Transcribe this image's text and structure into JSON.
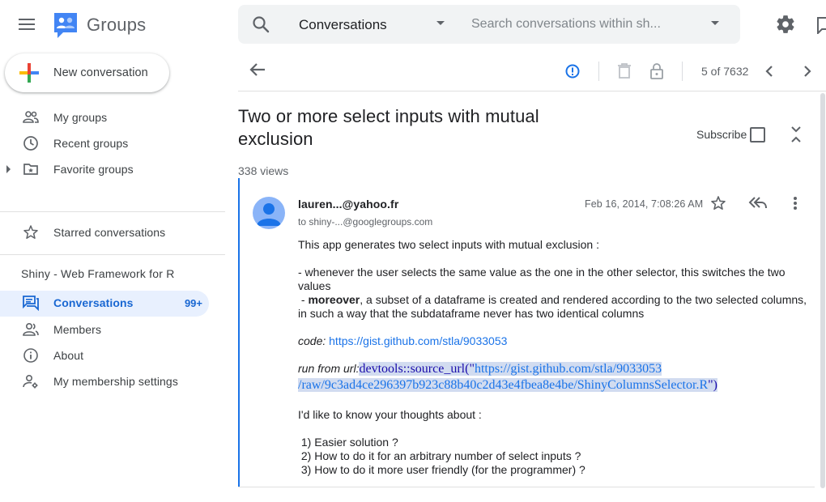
{
  "app": {
    "name": "Groups",
    "new_conversation": "New conversation"
  },
  "search": {
    "scope": "Conversations",
    "placeholder": "Search conversations within sh..."
  },
  "sidebar": {
    "items": [
      {
        "label": "My groups",
        "icon": "people-icon"
      },
      {
        "label": "Recent groups",
        "icon": "clock-icon"
      },
      {
        "label": "Favorite groups",
        "icon": "folder-star-icon"
      },
      {
        "label": "Starred conversations",
        "icon": "star-icon"
      }
    ],
    "group_title": "Shiny - Web Framework for R",
    "group_items": [
      {
        "label": "Conversations",
        "icon": "chat-icon",
        "count": "99+",
        "active": true
      },
      {
        "label": "Members",
        "icon": "members-icon"
      },
      {
        "label": "About",
        "icon": "info-icon"
      },
      {
        "label": "My membership settings",
        "icon": "person-settings-icon"
      }
    ]
  },
  "toolbar": {
    "pager": "5 of 7632"
  },
  "thread": {
    "title": "Two or more select inputs with mutual exclusion",
    "views": "338 views",
    "subscribe": "Subscribe"
  },
  "message": {
    "sender": "lauren...@yahoo.fr",
    "recipient": "to shiny-...@googlegroups.com",
    "date": "Feb 16, 2014, 7:08:26 AM",
    "intro": "This app generates two select inputs with mutual exclusion :",
    "bullet1": " - whenever the user selects the same value as the one in the other selector, this switches the two values",
    "bullet2_prefix": " - ",
    "bullet2_bold": "moreover",
    "bullet2_rest": ", a subset of a dataframe is created and rendered according to the two selected columns, in such a way that the subdataframe never has two identical columns",
    "code_label": "code:",
    "code_url": "https://gist.github.com/stla/9033053",
    "run_label": "run from url:",
    "run_fn": "devtools::source_url(\"",
    "run_url_1": "https://gist.github.com/stla/9033053",
    "run_url_2": "/raw/9c3ad4ce296397b923c88b40c2d43e4fbea8e4be/ShinyColumnsSelector.R",
    "run_end": "\")",
    "thoughts": "I'd like to know your thoughts about :",
    "q1": " 1) Easier solution ?",
    "q2": " 2) How to do it for an arbitrary number of select inputs ?",
    "q3": " 3) How to do it more user friendly (for the programmer) ?"
  },
  "colors": {
    "accent": "#1a73e8",
    "active_bg": "#e8f0fe",
    "active_text": "#1967d2",
    "search_bg": "#f1f3f4"
  }
}
